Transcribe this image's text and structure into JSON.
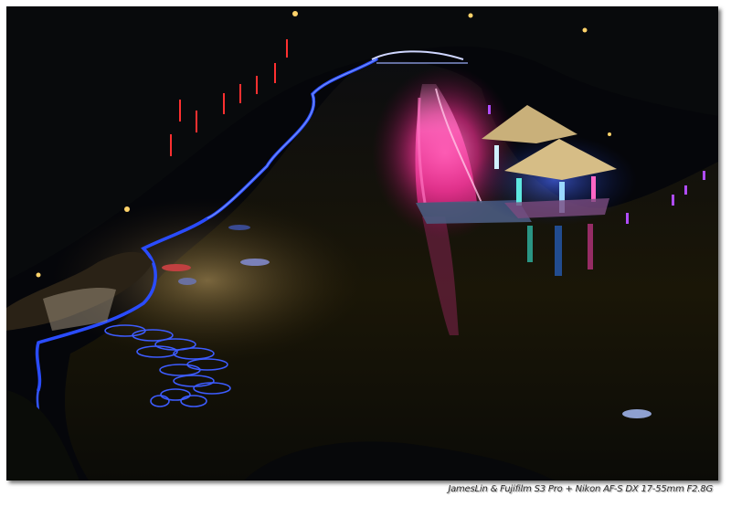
{
  "photo": {
    "credit": "JamesLin & Fujifilm S3 Pro + Nikon AF-S DX 17-55mm F2.8G"
  },
  "colors": {
    "background": "#06070b",
    "water": "#0b0d0a",
    "neon_blue": "#2a4cff",
    "fountain_magenta": "#ff3fa6",
    "pavilion_gold": "#c9b07a",
    "border": "#ffffff"
  }
}
